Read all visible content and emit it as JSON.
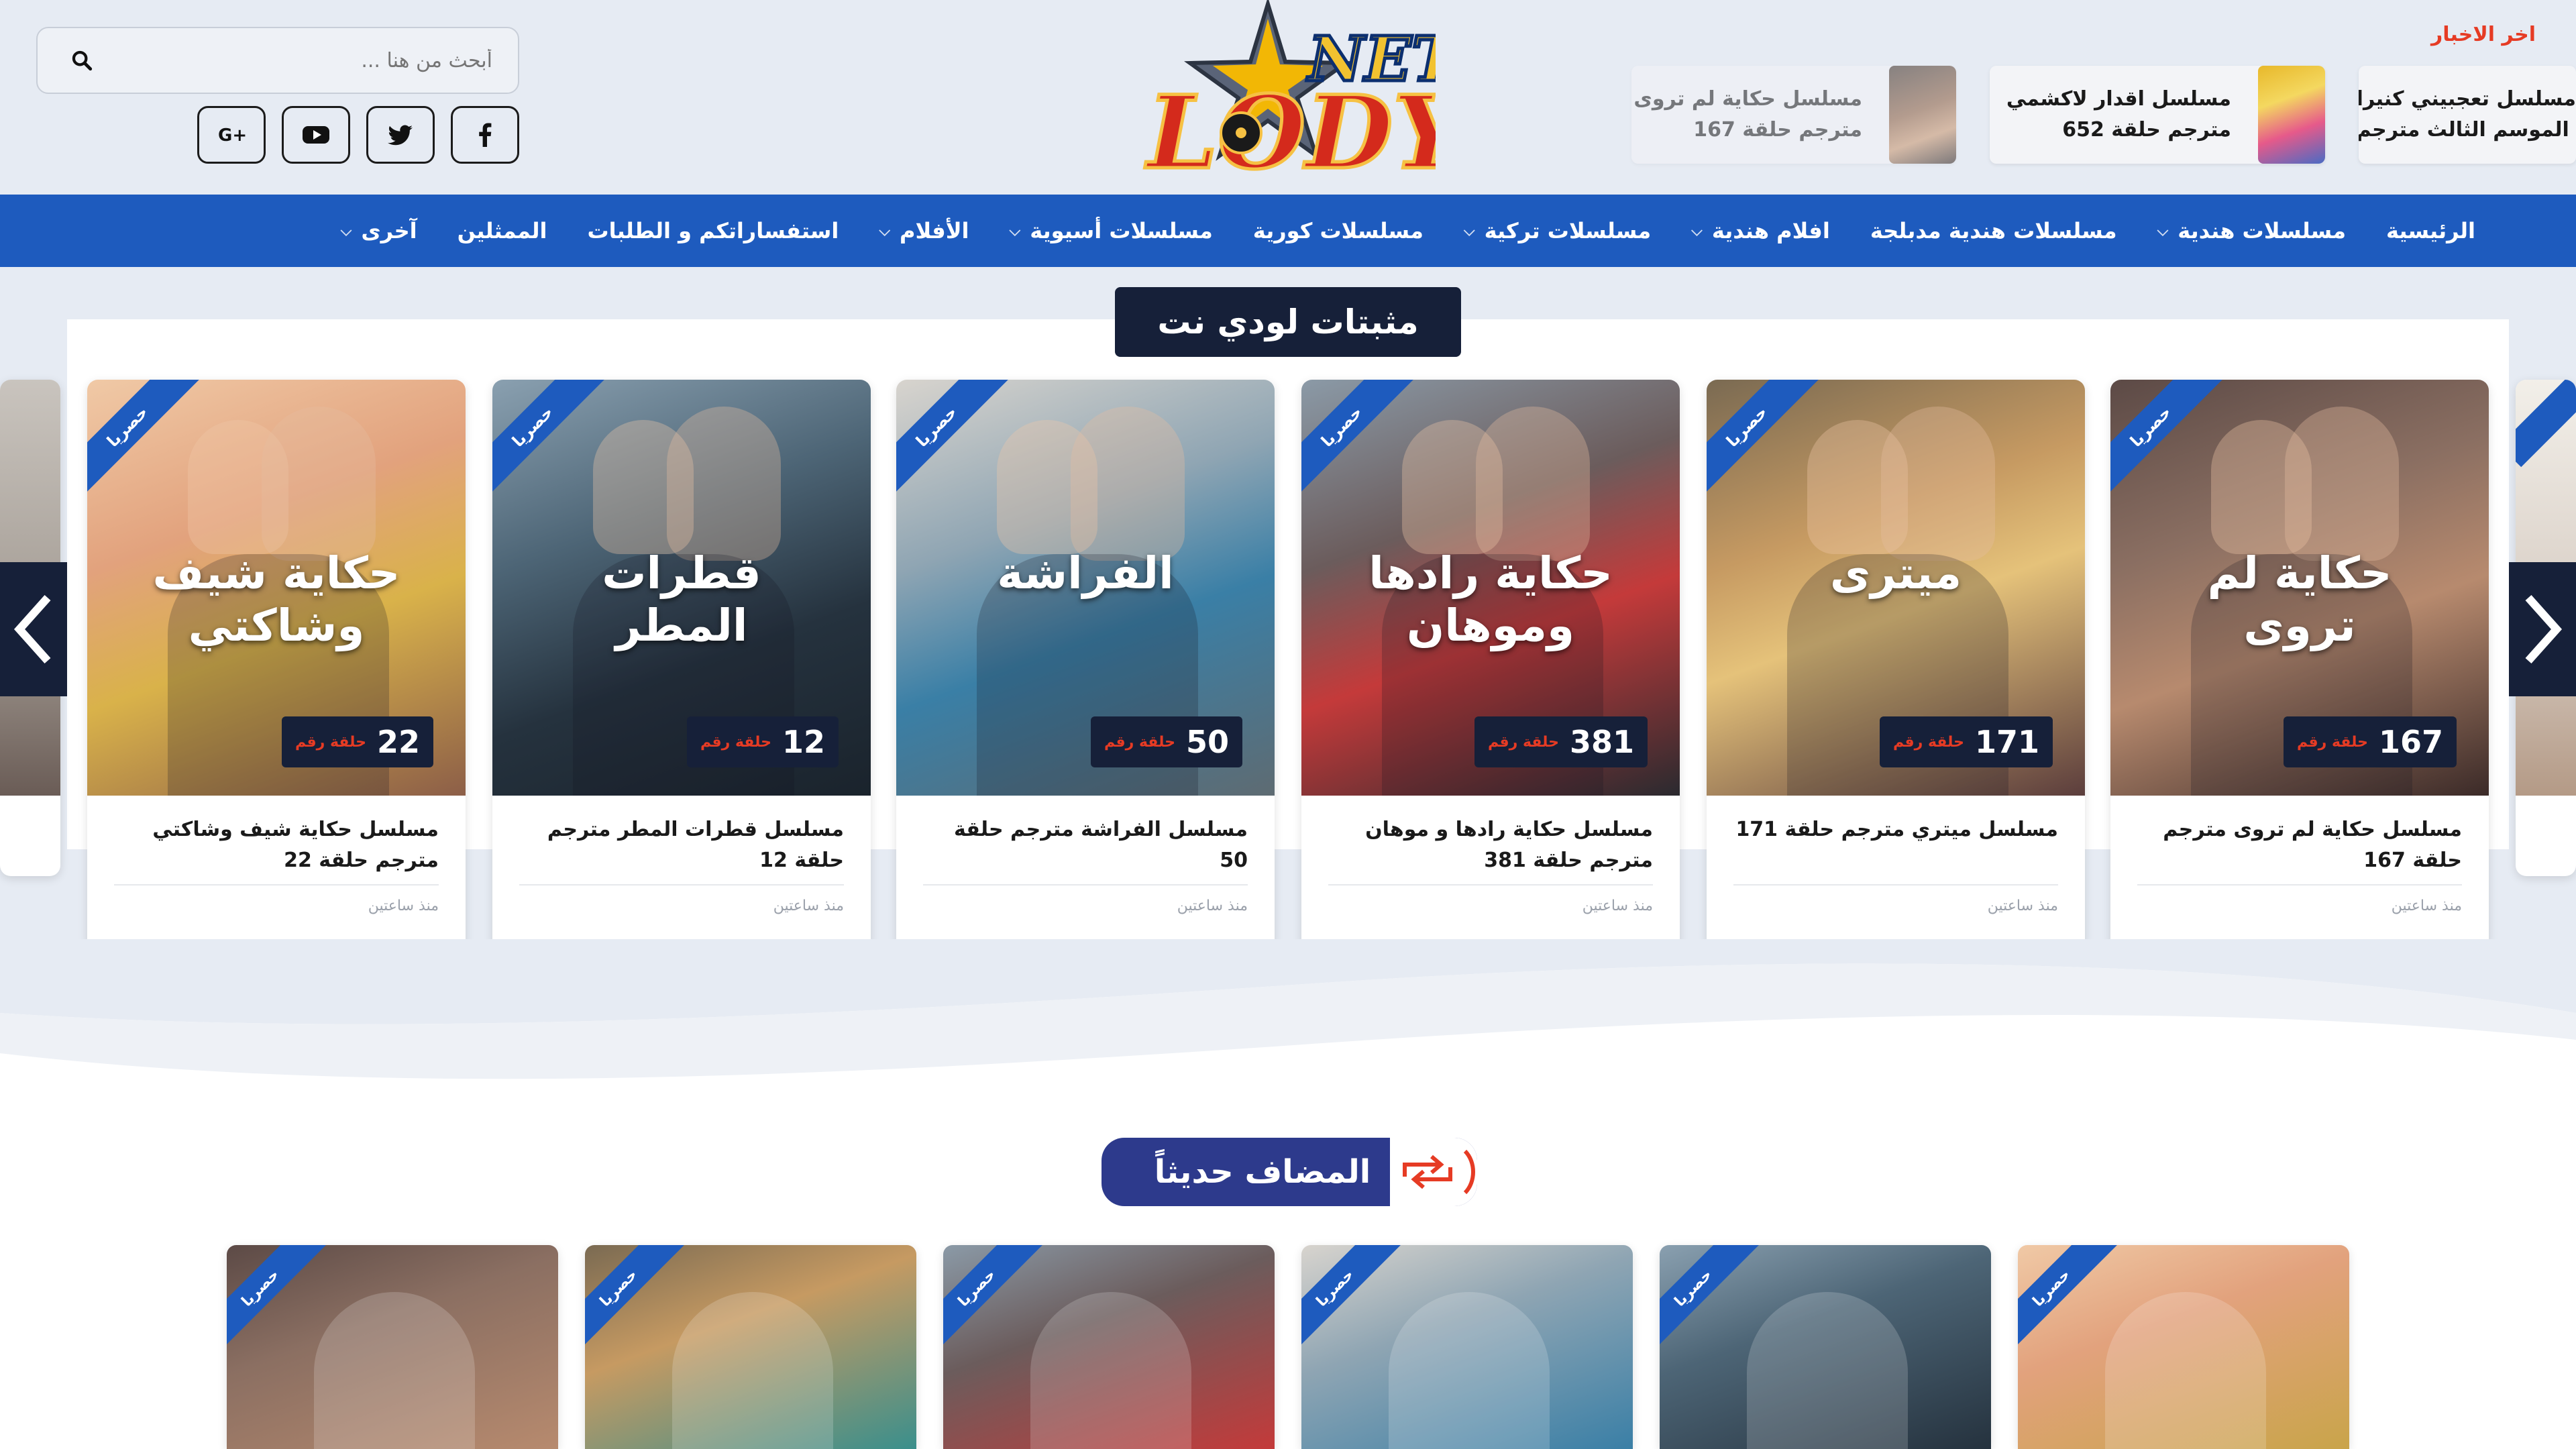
{
  "search": {
    "placeholder": "أبحث من هنا ..."
  },
  "logo": {
    "top_text": "NET",
    "main_text": "LODY"
  },
  "news": {
    "label": "اخر الاخبار",
    "items": [
      {
        "line1": "مسلسل حكاية لم تروى",
        "line2": "مترجم حلقة 167"
      },
      {
        "line1": "مسلسل اقدار لاكشمي",
        "line2": "مترجم حلقة 652"
      },
      {
        "line1": "مسلسل تعجبيني كنيرا",
        "line2": "الموسم الثالث مترجم"
      }
    ]
  },
  "nav": [
    {
      "label": "الرئيسية",
      "has_dropdown": false
    },
    {
      "label": "مسلسلات هندية",
      "has_dropdown": true
    },
    {
      "label": "مسلسلات هندية مدبلجة",
      "has_dropdown": false
    },
    {
      "label": "افلام هندية",
      "has_dropdown": true
    },
    {
      "label": "مسلسلات تركية",
      "has_dropdown": true
    },
    {
      "label": "مسلسلات كورية",
      "has_dropdown": false
    },
    {
      "label": "مسلسلات أسيوية",
      "has_dropdown": true
    },
    {
      "label": "الأفلام",
      "has_dropdown": true
    },
    {
      "label": "استفساراتكم و الطلبات",
      "has_dropdown": false
    },
    {
      "label": "الممثلين",
      "has_dropdown": false
    },
    {
      "label": "آخرى",
      "has_dropdown": true
    }
  ],
  "pinned": {
    "title": "مثبتات لودي نت",
    "ribbon": "حصريا",
    "ep_label": "حلقة رقم",
    "time": "منذ ساعتين",
    "cards": [
      {
        "title": "مسلسل حكاية لم تروى مترجم حلقة 167",
        "episode": "167",
        "poster_text": "حكاية لم تروى"
      },
      {
        "title": "مسلسل ميتري مترجم حلقة 171",
        "episode": "171",
        "poster_text": "ميترى"
      },
      {
        "title": "مسلسل حكاية رادها و موهان مترجم حلقة 381",
        "episode": "381",
        "poster_text": "حكاية رادها وموهان"
      },
      {
        "title": "مسلسل الفراشة مترجم حلقة 50",
        "episode": "50",
        "poster_text": "الفراشة"
      },
      {
        "title": "مسلسل قطرات المطر مترجم حلقة 12",
        "episode": "12",
        "poster_text": "قطرات المطر"
      },
      {
        "title": "مسلسل حكاية شيف وشاكتي مترجم حلقة 22",
        "episode": "22",
        "poster_text": "حكاية شيف وشاكتي"
      }
    ]
  },
  "recent": {
    "title": "المضاف حديثاً",
    "ribbon": "حصريا"
  },
  "colors": {
    "nav": "#1e5bbe",
    "dark": "#162039",
    "accent": "#e63b24",
    "recent_pill": "#2d3a8c"
  },
  "icons": {
    "search": "search-icon",
    "facebook": "facebook-icon",
    "twitter": "twitter-icon",
    "youtube": "youtube-icon",
    "google_plus": "google-plus-icon",
    "prev": "chevron-left-icon",
    "next": "chevron-right-icon",
    "refresh": "refresh-icon"
  }
}
